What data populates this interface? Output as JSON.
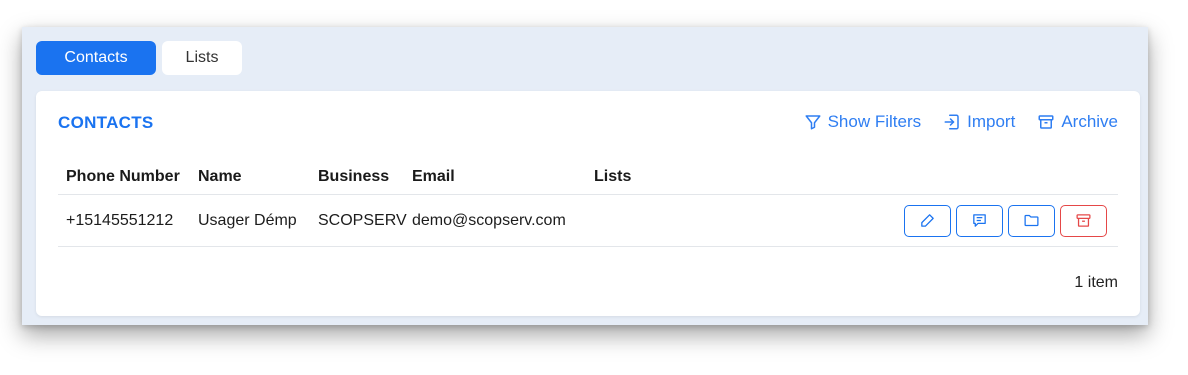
{
  "tabs": [
    {
      "label": "Contacts",
      "active": true
    },
    {
      "label": "Lists",
      "active": false
    }
  ],
  "card": {
    "title": "CONTACTS",
    "actions": {
      "filters": "Show Filters",
      "import": "Import",
      "archive": "Archive"
    }
  },
  "table": {
    "headers": [
      "Phone Number",
      "Name",
      "Business",
      "Email",
      "Lists"
    ],
    "rows": [
      {
        "phone": "+15145551212",
        "name": "Usager Démp",
        "business": "SCOPSERV",
        "email": "demo@scopserv.com",
        "lists": ""
      }
    ]
  },
  "footer": {
    "count": "1 item"
  },
  "colors": {
    "accent": "#1a73f0",
    "danger": "#e54848",
    "background": "#e6edf7"
  },
  "icons": [
    "filter-icon",
    "import-icon",
    "archive-icon",
    "edit-icon",
    "message-icon",
    "folder-icon",
    "archive-icon"
  ]
}
